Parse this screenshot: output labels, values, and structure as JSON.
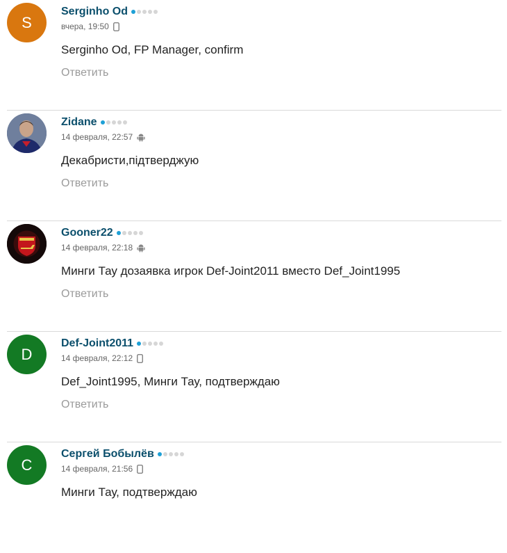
{
  "colors": {
    "author": "#0b4f6c",
    "rating_active": "#1ea0d6",
    "rating_inactive": "#d6d6d6",
    "meta": "#666666",
    "reply": "#9a9a9a",
    "divider": "#d9d9d9"
  },
  "comments": [
    {
      "avatar_letter": "S",
      "avatar_color": "#d9770f",
      "author": "Serginho Od",
      "rating": 1,
      "date": "вчера, 19:50",
      "device_icon": "mobile-phone-icon",
      "text": "Serginho Od, FP Manager, confirm",
      "reply_label": "Ответить"
    },
    {
      "avatar_letter": "",
      "avatar_image": "footballer-photo",
      "author": "Zidane",
      "rating": 1,
      "date": "14 февраля, 22:57",
      "device_icon": "android-icon",
      "text": "Декабристи,підтверджую",
      "reply_label": "Ответить"
    },
    {
      "avatar_letter": "",
      "avatar_image": "arsenal-crest",
      "author": "Gooner22",
      "rating": 1,
      "date": "14 февраля, 22:18",
      "device_icon": "android-icon",
      "text": "Минги Тау дозаявка игрок Def-Joint2011 вместо Def_Joint1995",
      "reply_label": "Ответить"
    },
    {
      "avatar_letter": "D",
      "avatar_color": "#137a24",
      "author": "Def-Joint2011",
      "rating": 1,
      "date": "14 февраля, 22:12",
      "device_icon": "mobile-phone-icon",
      "text": "Def_Joint1995, Минги Тау, подтверждаю",
      "reply_label": "Ответить"
    },
    {
      "avatar_letter": "C",
      "avatar_color": "#137a24",
      "author": "Сергей Бобылёв",
      "rating": 1,
      "date": "14 февраля, 21:56",
      "device_icon": "mobile-phone-icon",
      "text": "Минги Тау, подтверждаю",
      "reply_label": ""
    }
  ]
}
